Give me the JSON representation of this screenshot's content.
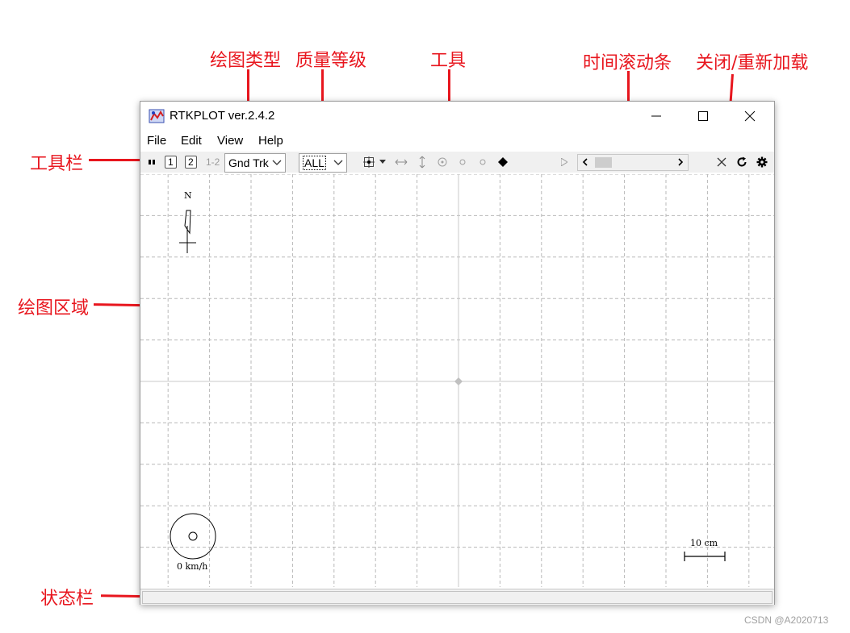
{
  "annotations": {
    "plot_type": "绘图类型",
    "quality_level": "质量等级",
    "tools": "工具",
    "time_scroll": "时间滚动条",
    "close_reload": "关闭/重新加载",
    "toolbar": "工具栏",
    "plot_area": "绘图区域",
    "status_bar": "状态栏"
  },
  "window": {
    "title": "RTKPLOT ver.2.4.2"
  },
  "menu": {
    "file": "File",
    "edit": "Edit",
    "view": "View",
    "help": "Help"
  },
  "toolbar": {
    "btn_1": "1",
    "btn_2": "2",
    "btn_12": "1-2",
    "plot_type_value": "Gnd Trk",
    "quality_value": "ALL"
  },
  "plot": {
    "north_label": "N",
    "speed_label": "0 km/h",
    "scale_label": "10 cm"
  },
  "watermark": "CSDN @A2020713",
  "colors": {
    "annotation": "#e8161e",
    "grid": "#b8b8b8",
    "axis": "#c8c8c8"
  }
}
